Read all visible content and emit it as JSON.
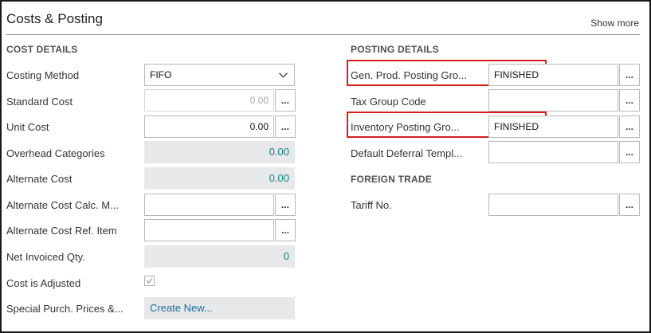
{
  "panel": {
    "title": "Costs & Posting",
    "show_more": "Show more"
  },
  "cost_details": {
    "heading": "COST DETAILS",
    "costing_method": {
      "label": "Costing Method",
      "value": "FIFO"
    },
    "standard_cost": {
      "label": "Standard Cost",
      "value": "0.00"
    },
    "unit_cost": {
      "label": "Unit Cost",
      "value": "0.00"
    },
    "overhead_categories": {
      "label": "Overhead Categories",
      "value": "0.00"
    },
    "alternate_cost": {
      "label": "Alternate Cost",
      "value": "0.00"
    },
    "alt_cost_calc": {
      "label": "Alternate Cost Calc. M...",
      "value": ""
    },
    "alt_cost_ref": {
      "label": "Alternate Cost Ref. Item",
      "value": ""
    },
    "net_invoiced_qty": {
      "label": "Net Invoiced Qty.",
      "value": "0"
    },
    "cost_is_adjusted": {
      "label": "Cost is Adjusted",
      "checked": true
    },
    "special_purch": {
      "label": "Special Purch. Prices &...",
      "value": "Create New..."
    }
  },
  "posting_details": {
    "heading": "POSTING DETAILS",
    "gen_prod_posting": {
      "label": "Gen. Prod. Posting Gro...",
      "value": "FINISHED"
    },
    "tax_group_code": {
      "label": "Tax Group Code",
      "value": ""
    },
    "inventory_posting": {
      "label": "Inventory Posting Gro...",
      "value": "FINISHED"
    },
    "default_deferral": {
      "label": "Default Deferral Templ...",
      "value": ""
    }
  },
  "foreign_trade": {
    "heading": "FOREIGN TRADE",
    "tariff_no": {
      "label": "Tariff No.",
      "value": ""
    }
  },
  "lookup_button": "...",
  "colors": {
    "highlight": "#d32020",
    "readonly_bg": "#e6e8ea",
    "value_teal": "#148088",
    "link_blue": "#1a6f96"
  }
}
